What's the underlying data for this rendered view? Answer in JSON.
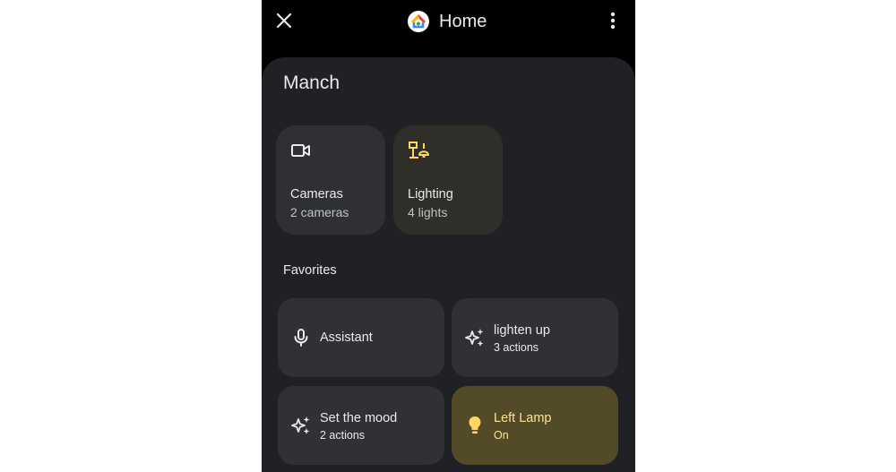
{
  "header": {
    "title": "Home",
    "icons": {
      "close": "close-icon",
      "logo": "google-home-logo",
      "more": "more-vert-icon"
    }
  },
  "room": {
    "name": "Manch"
  },
  "categories": [
    {
      "label": "Cameras",
      "sub": "2 cameras",
      "icon": "camera-icon"
    },
    {
      "label": "Lighting",
      "sub": "4 lights",
      "icon": "lamp-icon"
    }
  ],
  "favorites": {
    "label": "Favorites",
    "items": [
      {
        "label": "Assistant",
        "sub": "",
        "icon": "mic-icon"
      },
      {
        "label": "lighten up",
        "sub": "3 actions",
        "icon": "sparkle-icon"
      },
      {
        "label": "Set the mood",
        "sub": "2 actions",
        "icon": "sparkle-icon"
      },
      {
        "label": "Left Lamp",
        "sub": "On",
        "icon": "bulb-icon"
      }
    ]
  },
  "colors": {
    "background": "#000000",
    "sheet": "#202124",
    "card": "#303134",
    "lighting_card": "#2f2e28",
    "lamp_on_card": "#534b28",
    "lamp_on_text": "#fde293",
    "icon_yellow": "#fdd663"
  }
}
